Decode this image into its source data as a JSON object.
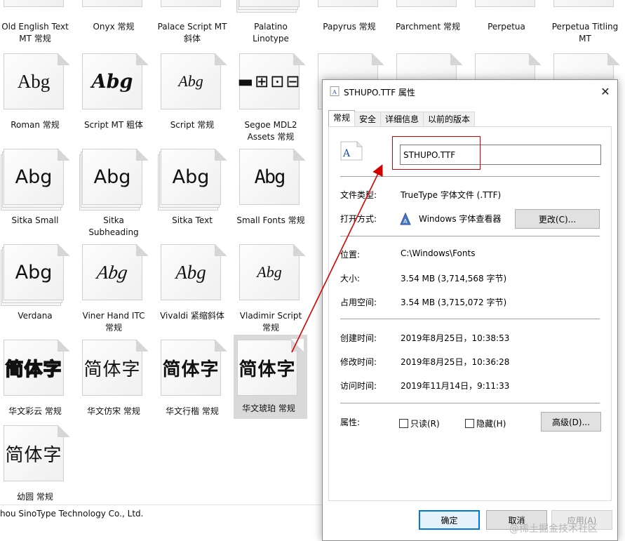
{
  "grid": {
    "top_row": [
      {
        "name": "Old English Text MT 常规"
      },
      {
        "name": "Onyx 常规"
      },
      {
        "name": "Palace Script MT 斜体"
      },
      {
        "name": "Palatino Linotype"
      },
      {
        "name": "Papyrus 常规"
      },
      {
        "name": "Parchment 常规"
      },
      {
        "name": "Perpetua"
      },
      {
        "name": "Perpetua Titling MT"
      }
    ],
    "row1": [
      {
        "sample": "Abg",
        "name": "Roman 常规"
      },
      {
        "sample": "Abg",
        "name": "Script MT 粗体"
      },
      {
        "sample": "Abg",
        "name": "Script 常规"
      },
      {
        "sample": "▬⊞⊡⊟",
        "name": "Segoe MDL2 Assets 常规"
      }
    ],
    "row2": [
      {
        "sample": "Abg",
        "name": "Sitka Small"
      },
      {
        "sample": "Abg",
        "name": "Sitka Subheading"
      },
      {
        "sample": "Abg",
        "name": "Sitka Text"
      },
      {
        "sample": "Abg",
        "name": "Small Fonts 常规"
      }
    ],
    "row3": [
      {
        "sample": "Abg",
        "name": "Verdana"
      },
      {
        "sample": "Abg",
        "name": "Viner Hand ITC 常规"
      },
      {
        "sample": "Abg",
        "name": "Vivaldi 紧缩斜体"
      },
      {
        "sample": "Abg",
        "name": "Vladimir Script 常规"
      }
    ],
    "row4": [
      {
        "sample": "简体字",
        "name": "华文彩云 常规"
      },
      {
        "sample": "简体字",
        "name": "华文仿宋 常规"
      },
      {
        "sample": "简体字",
        "name": "华文行楷 常规"
      },
      {
        "sample": "简体字",
        "name": "华文琥珀 常规"
      }
    ],
    "row5": [
      {
        "sample": "简体字",
        "name": "幼圆 常规"
      }
    ],
    "footer": "hou SinoType Technology Co., Ltd."
  },
  "dialog": {
    "title": "STHUPO.TTF 属性",
    "tabs": [
      "常规",
      "安全",
      "详细信息",
      "以前的版本"
    ],
    "filename": "STHUPO.TTF",
    "file_type_label": "文件类型:",
    "file_type_value": "TrueType 字体文件 (.TTF)",
    "open_with_label": "打开方式:",
    "open_with_value": "Windows 字体查看器",
    "change_button": "更改(C)...",
    "location_label": "位置:",
    "location_value": "C:\\Windows\\Fonts",
    "size_label": "大小:",
    "size_value": "3.54 MB (3,714,568 字节)",
    "disk_size_label": "占用空间:",
    "disk_size_value": "3.54 MB (3,715,072 字节)",
    "created_label": "创建时间:",
    "created_value": "2019年8月25日，10:38:53",
    "modified_label": "修改时间:",
    "modified_value": "2019年8月25日，10:36:28",
    "accessed_label": "访问时间:",
    "accessed_value": "2019年11月14日，9:11:33",
    "attributes_label": "属性:",
    "readonly_label": "只读(R)",
    "hidden_label": "隐藏(H)",
    "advanced_button": "高级(D)...",
    "ok_button": "确定",
    "cancel_button": "取消",
    "apply_button": "应用(A)"
  },
  "watermark": "@稀土掘金技术社区",
  "colors": {
    "annotation": "#d40000",
    "focus": "#0078d7"
  }
}
